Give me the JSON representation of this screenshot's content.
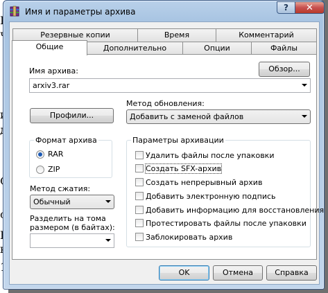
{
  "background_text": [
    "Г",
    "ч",
    "и",
    "д",
    "С",
    "о",
    "Н",
    "к",
    "1"
  ],
  "window": {
    "title": "Имя и параметры архива",
    "help_label": "?",
    "close_label": "✕"
  },
  "tabs": {
    "top_row": [
      "Резервные копии",
      "Время",
      "Комментарий"
    ],
    "bottom_row": [
      "Общие",
      "Дополнительно",
      "Опции",
      "Файлы"
    ],
    "active": "Общие"
  },
  "archive_name": {
    "label": "Имя архива:",
    "value": "arxiv3.rar",
    "browse_label": "Обзор..."
  },
  "update_method": {
    "label": "Метод обновления:",
    "value": "Добавить с заменой файлов"
  },
  "profiles_label": "Профили...",
  "format": {
    "title": "Формат архива",
    "options": [
      "RAR",
      "ZIP"
    ],
    "selected": "RAR"
  },
  "compression": {
    "label": "Метод сжатия:",
    "value": "Обычный"
  },
  "split": {
    "label_line1": "Разделить на тома",
    "label_line2": "размером (в байтах):",
    "value": ""
  },
  "params": {
    "title": "Параметры архивации",
    "items": [
      {
        "label": "Удалить файлы после упаковки",
        "checked": false
      },
      {
        "label": "Создать SFX-архив",
        "checked": false
      },
      {
        "label": "Создать непрерывный архив",
        "checked": false
      },
      {
        "label": "Добавить электронную подпись",
        "checked": false
      },
      {
        "label": "Добавить информацию для восстановления",
        "checked": false
      },
      {
        "label": "Протестировать файлы после упаковки",
        "checked": false
      },
      {
        "label": "Заблокировать архив",
        "checked": false
      }
    ]
  },
  "footer": {
    "ok": "OK",
    "cancel": "Отмена",
    "help": "Справка"
  }
}
